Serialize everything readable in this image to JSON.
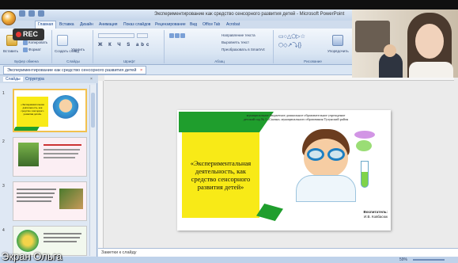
{
  "window": {
    "title": "Экспериментирование как средство сенсорного развития детей - Microsoft PowerPoint"
  },
  "recording": {
    "label": "REC"
  },
  "ribbon": {
    "tabs": [
      "Главная",
      "Вставка",
      "Дизайн",
      "Анимация",
      "Показ слайдов",
      "Рецензирование",
      "Вид",
      "Office Tab",
      "Acrobat"
    ],
    "active_tab": "Главная",
    "clipboard": {
      "paste": "Вставить",
      "cut": "Вырезать",
      "copy": "Копировать",
      "format": "Формат",
      "label": "Буфер обмена"
    },
    "slides": {
      "create": "Создать слайд",
      "delete": "Удалить",
      "label": "Слайды"
    },
    "font": {
      "label": "Шрифт"
    },
    "paragraph": {
      "direction": "Направление текста",
      "align": "Выровнять текст",
      "smartart": "Преобразовать в SmartArt",
      "label": "Абзац"
    },
    "drawing": {
      "arrange": "Упорядочить",
      "label": "Рисование"
    }
  },
  "document_tab": {
    "label": "Экспериментирование как средство сенсорного развития детей"
  },
  "outline": {
    "tabs": [
      "Слайды",
      "Структура"
    ]
  },
  "thumbnails": [
    {
      "number": "1",
      "title": "«Экспериментальная деятельность, как средство сенсорного развития детей»"
    },
    {
      "number": "2"
    },
    {
      "number": "3"
    },
    {
      "number": "4"
    }
  ],
  "slide": {
    "header_line1": "муниципальное бюджетное дошкольное образовательное учреждение",
    "header_line2": "детский сад № 1 «Сказка» муниципального образования Тулунский район",
    "title": "«Экспериментальная деятельность, как средство сенсорного развития детей»",
    "caregiver_label": "Воспитатель:",
    "caregiver_name": "И.В. Ковбасюк"
  },
  "notes": {
    "placeholder": "Заметки к слайду"
  },
  "status": {
    "zoom": "59%"
  },
  "caption": "Экран Ольга",
  "colors": {
    "slide_yellow": "#f8ea17",
    "slide_green": "#1f9e2d",
    "rec_dot": "#e53935"
  }
}
